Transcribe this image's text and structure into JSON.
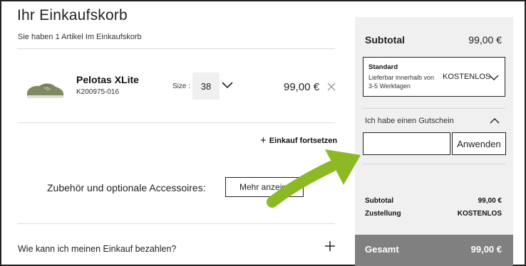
{
  "cart": {
    "title": "Ihr Einkaufskorb",
    "count_text": "Sie haben  1 Artikel Im Einkaufskorb",
    "item": {
      "name": "Pelotas XLite",
      "ref": "K200975-016",
      "size_label": "Size :",
      "size_value": "38",
      "price": "99,00 €"
    },
    "continue_label": "Einkauf fortsetzen",
    "accessories_label": "Zubehör und optionale Accessoires:",
    "more_button": "Mehr anzeigen",
    "payment_question": "Wie kann ich meinen Einkauf bezahlen?"
  },
  "summary": {
    "subtotal_label": "Subtotal",
    "subtotal_value": "99,00 €",
    "shipping": {
      "name": "Standard",
      "description": "Lieferbar innerhalb von 3-5 Werktagen",
      "price": "KOSTENLOS"
    },
    "coupon_label": "Ich habe einen Gutschein",
    "coupon_value": "",
    "apply_button": "Anwenden",
    "rows": [
      {
        "label": "Subtotal",
        "value": "99,00 €"
      },
      {
        "label": "Zustellung",
        "value": "KOSTENLOS"
      }
    ],
    "total_label": "Gesamt",
    "total_value": "99,00 €"
  },
  "colors": {
    "panel_bg": "#f0f0f0",
    "total_bar": "#808080",
    "annotation_arrow": "#8cba24"
  },
  "icons": [
    "shoe-thumbnail",
    "chevron-down-icon",
    "close-icon",
    "plus-icon",
    "chevron-up-icon",
    "annotation-arrow-icon"
  ]
}
